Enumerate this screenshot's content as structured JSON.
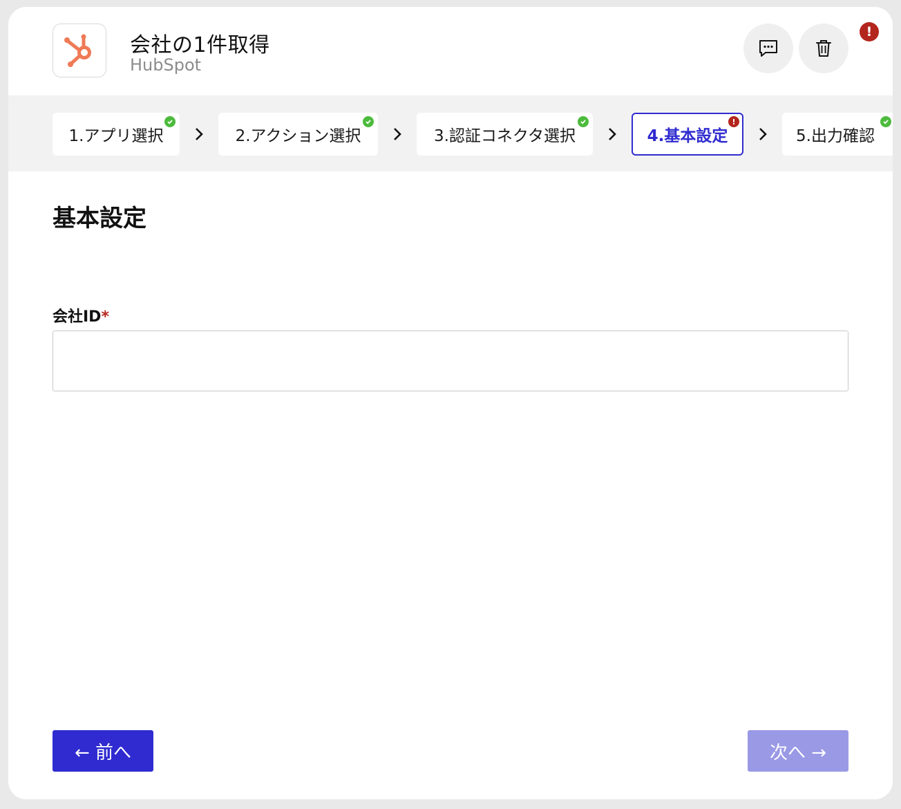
{
  "header": {
    "action_title": "会社の1件取得",
    "app_name": "HubSpot",
    "logo_icon": "hubspot-logo",
    "comment_icon": "comment-icon",
    "delete_icon": "trash-icon",
    "error_badge": "!"
  },
  "colors": {
    "accent": "#2f2bd0",
    "accent_disabled": "#9a99e6",
    "success": "#4cbb3c",
    "error": "#b3261e",
    "hubspot_orange": "#ef7a56"
  },
  "steps": [
    {
      "label": "1.アプリ選択",
      "status": "complete"
    },
    {
      "label": "2.アクション選択",
      "status": "complete"
    },
    {
      "label": "3.認証コネクタ選択",
      "status": "complete"
    },
    {
      "label": "4.基本設定",
      "status": "error",
      "active": true,
      "error_mark": "!"
    },
    {
      "label": "5.出力確認",
      "status": "complete"
    }
  ],
  "main": {
    "section_title": "基本設定",
    "field_label": "会社ID",
    "required_mark": "*",
    "field_value": ""
  },
  "footer": {
    "prev_label": "← 前へ",
    "next_label": "次へ →"
  }
}
